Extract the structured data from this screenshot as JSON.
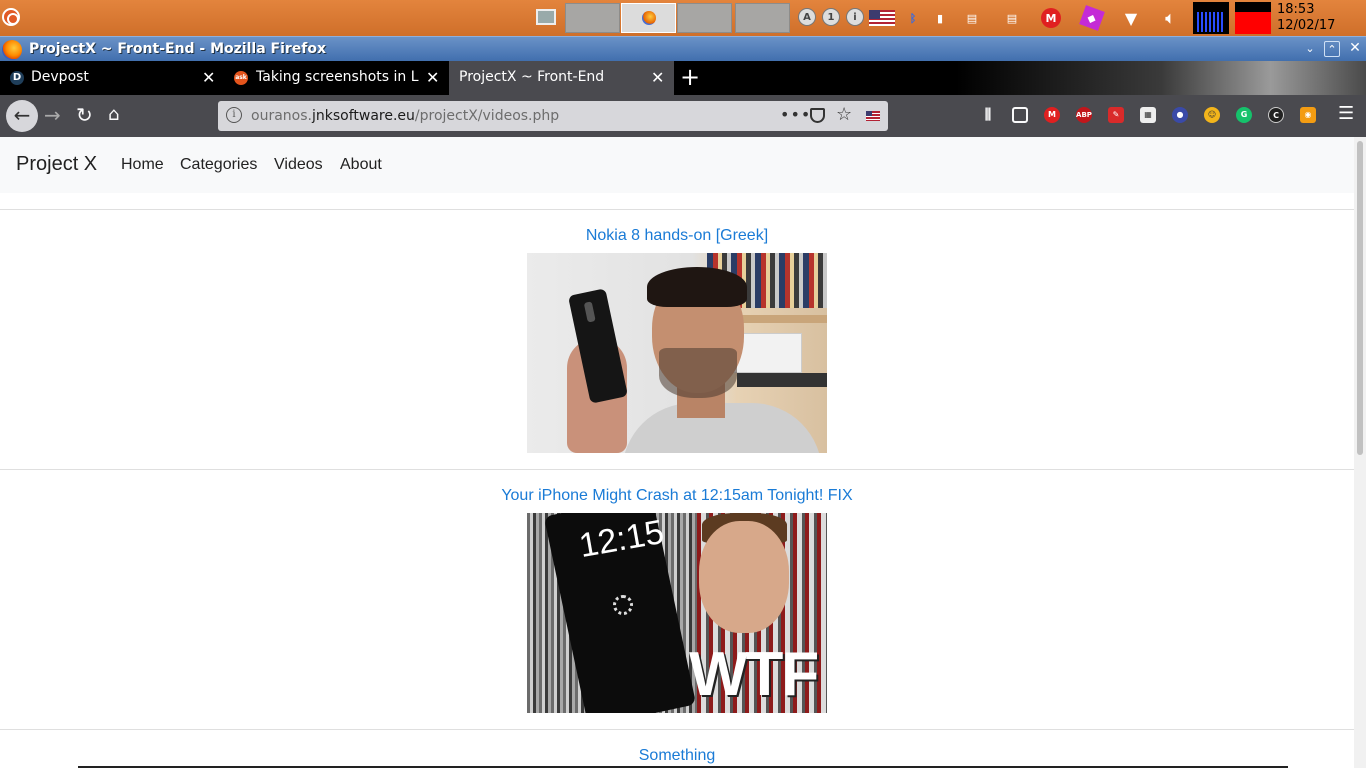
{
  "system_panel": {
    "clock_time": "18:53",
    "clock_date": "12/02/17"
  },
  "window": {
    "title": "ProjectX ~ Front-End - Mozilla Firefox"
  },
  "tabs": [
    {
      "label": "Devpost",
      "favicon": "D"
    },
    {
      "label": "Taking screenshots in Lubuntu",
      "favicon": "ask"
    },
    {
      "label": "ProjectX ~ Front-End",
      "selected": true
    }
  ],
  "urlbar": {
    "prefix": "ouranos.",
    "domain": "jnksoftware.eu",
    "path": "/projectX/videos.php"
  },
  "site": {
    "brand": "Project X",
    "nav": [
      "Home",
      "Categories",
      "Videos",
      "About"
    ]
  },
  "videos": [
    {
      "title": "Nokia 8 hands-on [Greek]"
    },
    {
      "title": "Your iPhone Might Crash at 12:15am Tonight! FIX",
      "thumb_clock": "12:15",
      "thumb_overlay": "WTF"
    },
    {
      "title": "Something"
    }
  ],
  "colors": {
    "link": "#1a7bd6",
    "panel": "#d87a33",
    "titlebar": "#4f7bb8",
    "browser_chrome": "#4a4a4f"
  }
}
